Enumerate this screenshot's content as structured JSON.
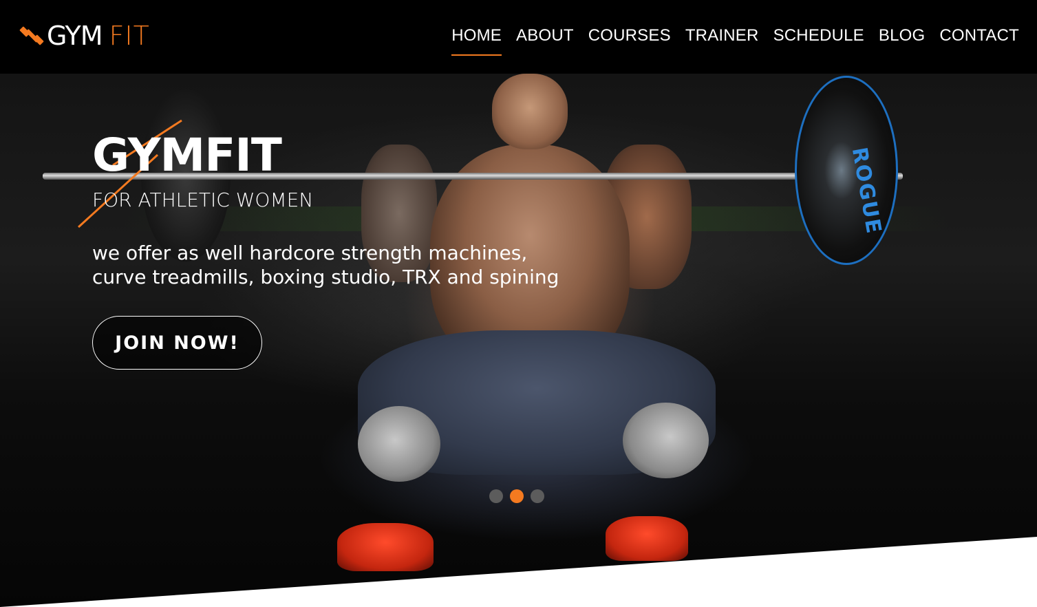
{
  "brand": {
    "name_primary": "GYM",
    "name_secondary": "FIT",
    "accent_color": "#f47a20",
    "logo_icon": "dumbbell-icon"
  },
  "nav": {
    "items": [
      {
        "label": "HOME",
        "active": true
      },
      {
        "label": "ABOUT",
        "active": false
      },
      {
        "label": "COURSES",
        "active": false
      },
      {
        "label": "TRAINER",
        "active": false
      },
      {
        "label": "SCHEDULE",
        "active": false
      },
      {
        "label": "BLOG",
        "active": false
      },
      {
        "label": "CONTACT",
        "active": false
      }
    ]
  },
  "hero": {
    "title": "GYMFIT",
    "subtitle": "FOR ATHLETIC WOMEN",
    "description_line1": "we offer as well hardcore strength machines,",
    "description_line2": "curve treadmills, boxing studio, TRX and spining",
    "cta_label": "JOIN NOW!",
    "plate_text": "ROGUE",
    "slider": {
      "count": 3,
      "active_index": 1
    }
  }
}
